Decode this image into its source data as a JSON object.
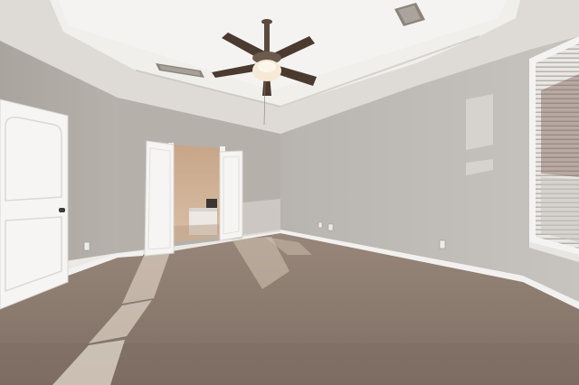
{
  "scene": {
    "subject": "empty-bedroom-interior",
    "objects": [
      "tray-ceiling",
      "ceiling-fan",
      "ceiling-vents",
      "left-door",
      "double-doors",
      "bathroom-vanity",
      "window-with-blinds",
      "carpet-floor",
      "baseboards",
      "wall-outlets"
    ]
  },
  "colors": {
    "wall": "#b4b0ab",
    "wall_shadow": "#a8a39d",
    "ceiling": "#e3e0dc",
    "ceiling_recess": "#f0eeeb",
    "carpet": "#8d7c72",
    "carpet_dark": "#7a6a60",
    "door": "#f6f5f3",
    "trim": "#f2f1ef",
    "fan_blade": "#4b3a30",
    "bathroom": "#c9a98c",
    "sunlight": "#f5ede2"
  }
}
